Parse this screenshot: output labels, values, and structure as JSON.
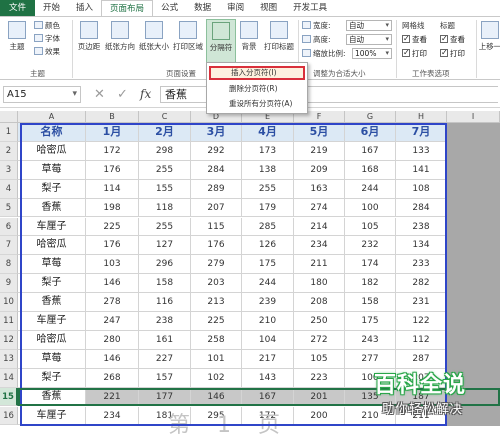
{
  "tabs": [
    "文件",
    "开始",
    "插入",
    "页面布局",
    "公式",
    "数据",
    "审阅",
    "视图",
    "开发工具"
  ],
  "active_tab": "页面布局",
  "ribbon": {
    "theme_group": {
      "big": "主题",
      "colors": "颜色",
      "fonts": "字体",
      "effects": "效果",
      "label": "主题"
    },
    "page_setup": {
      "margins": "页边距",
      "orientation": "纸张方向",
      "size": "纸张大小",
      "print_area": "打印区域",
      "breaks": "分隔符",
      "background": "背景",
      "print_titles": "打印标题",
      "label": "页面设置"
    },
    "scale": {
      "width_label": "宽度:",
      "width_value": "自动",
      "height_label": "高度:",
      "height_value": "自动",
      "scale_label": "缩放比例:",
      "scale_value": "100%",
      "label": "调整为合适大小"
    },
    "sheet_options": {
      "gridlines": "网格线",
      "headings": "标题",
      "view1": "查看",
      "view2": "查看",
      "print1": "打印",
      "print2": "打印",
      "label": "工作表选项"
    },
    "arrange": {
      "bring_forward": "上移一"
    }
  },
  "breaks_menu": {
    "items": [
      "插入分页符(I)",
      "删除分页符(R)",
      "重设所有分页符(A)"
    ],
    "highlighted": 0
  },
  "formula_bar": {
    "name_box": "A15",
    "cancel": "✕",
    "enter": "✓",
    "fx": "fx",
    "value": "香蕉"
  },
  "columns": [
    "A",
    "B",
    "C",
    "D",
    "E",
    "F",
    "G",
    "H",
    "I"
  ],
  "header_row": [
    "名称",
    "1月",
    "2月",
    "3月",
    "4月",
    "5月",
    "6月",
    "7月"
  ],
  "rows": [
    [
      "哈密瓜",
      "172",
      "298",
      "292",
      "173",
      "219",
      "167",
      "133"
    ],
    [
      "草莓",
      "176",
      "255",
      "284",
      "138",
      "209",
      "168",
      "141"
    ],
    [
      "梨子",
      "114",
      "155",
      "289",
      "255",
      "163",
      "244",
      "108"
    ],
    [
      "香蕉",
      "198",
      "118",
      "207",
      "179",
      "274",
      "100",
      "284"
    ],
    [
      "车厘子",
      "225",
      "255",
      "115",
      "285",
      "214",
      "105",
      "238"
    ],
    [
      "哈密瓜",
      "176",
      "127",
      "176",
      "126",
      "234",
      "232",
      "134"
    ],
    [
      "草莓",
      "103",
      "296",
      "279",
      "175",
      "211",
      "174",
      "233"
    ],
    [
      "梨子",
      "146",
      "158",
      "203",
      "244",
      "180",
      "182",
      "282"
    ],
    [
      "香蕉",
      "278",
      "116",
      "213",
      "239",
      "208",
      "158",
      "231"
    ],
    [
      "车厘子",
      "247",
      "238",
      "225",
      "210",
      "250",
      "175",
      "122"
    ],
    [
      "哈密瓜",
      "280",
      "161",
      "258",
      "104",
      "272",
      "243",
      "112"
    ],
    [
      "草莓",
      "146",
      "227",
      "101",
      "217",
      "105",
      "277",
      "287"
    ],
    [
      "梨子",
      "268",
      "157",
      "102",
      "143",
      "223",
      "100",
      "207"
    ],
    [
      "香蕉",
      "221",
      "177",
      "146",
      "167",
      "201",
      "135",
      "187"
    ],
    [
      "车厘子",
      "234",
      "181",
      "295",
      "172",
      "200",
      "210",
      "211"
    ]
  ],
  "row_numbers": [
    "1",
    "2",
    "3",
    "4",
    "5",
    "6",
    "7",
    "8",
    "9",
    "10",
    "11",
    "12",
    "13",
    "14",
    "15",
    "16"
  ],
  "selected_row": "15",
  "page_watermark": "第 1 页",
  "brand": {
    "title": "百科全说",
    "subtitle": "助你轻松解决"
  },
  "colors": {
    "excel_green": "#217346",
    "page_break_blue": "#2f45c8",
    "header_text": "#2c4fa3",
    "menu_highlight": "#d9303b"
  }
}
